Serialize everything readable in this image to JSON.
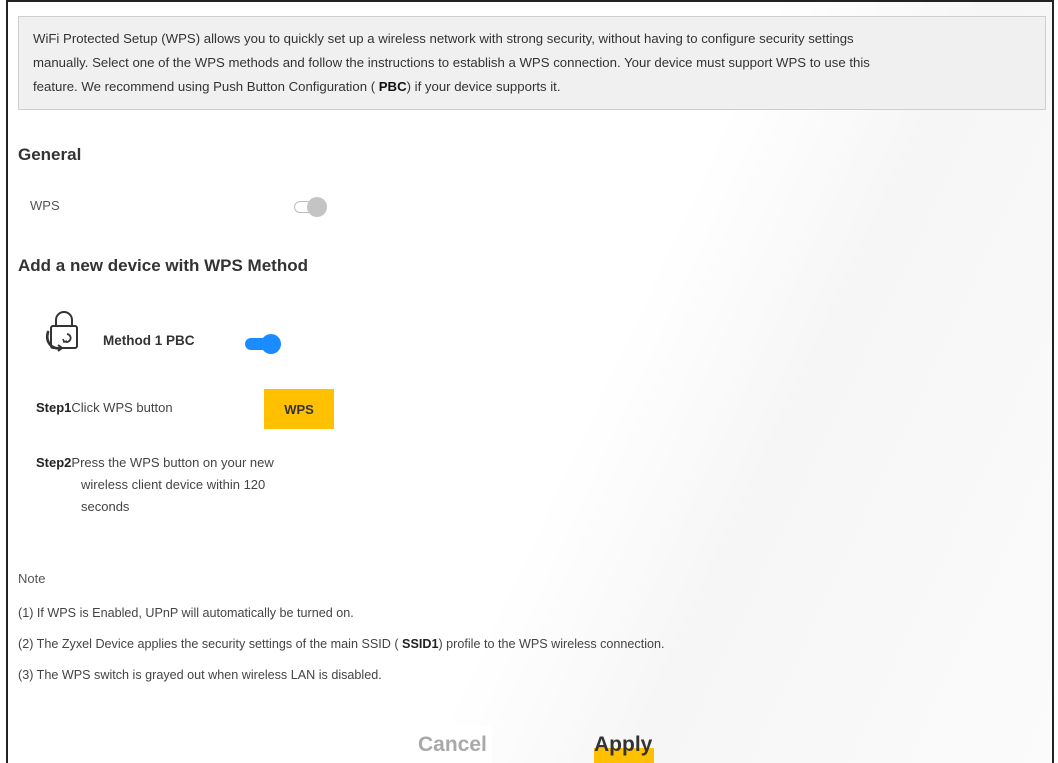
{
  "intro": {
    "line1": "WiFi Protected Setup (WPS) allows you to quickly set up a wireless network with strong security, without having to configure security settings",
    "line2": "manually. Select one of the WPS methods and follow the instructions to establish a WPS connection. Your device must support WPS to use this",
    "line3_prefix": "feature. We recommend using Push Button Configuration ( ",
    "line3_bold": "PBC",
    "line3_suffix": ") if your device supports it."
  },
  "general": {
    "title": "General",
    "wps_label": "WPS",
    "wps_enabled": false
  },
  "method_section": {
    "title": "Add a new device with WPS Method",
    "method1_label": "Method 1 PBC",
    "method1_enabled": true,
    "icon": "lock-cycle-icon",
    "step1_label": "Step1",
    "step1_text": "Click WPS button",
    "wps_button_label": "WPS",
    "step2_label": "Step2",
    "step2_line1": "Press the WPS button on your new",
    "step2_line2": "wireless client device within 120",
    "step2_line3": "seconds"
  },
  "notes": {
    "title": "Note",
    "n1": "(1) If WPS is Enabled, UPnP will automatically be turned on.",
    "n2_prefix": "(2) The Zyxel Device applies the security settings of the main SSID ( ",
    "n2_bold": "SSID1",
    "n2_suffix": ") profile to the WPS wireless connection.",
    "n3": "(3) The WPS switch is grayed out when wireless LAN is disabled."
  },
  "footer": {
    "cancel_label": "Cancel",
    "apply_label": "Apply"
  },
  "colors": {
    "accent_yellow": "#ffc000",
    "toggle_on_blue": "#1a8cff",
    "toggle_off_gray": "#c4c4c4"
  }
}
